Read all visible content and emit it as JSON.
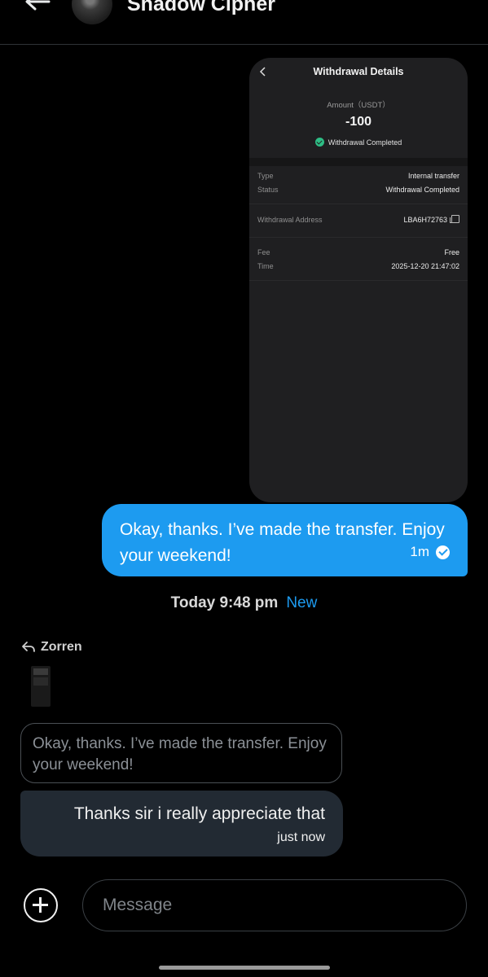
{
  "header": {
    "contact_name": "Shadow Cipher"
  },
  "attachment": {
    "title": "Withdrawal Details",
    "amount_label": "Amount（USDT）",
    "amount": "-100",
    "status_badge": "Withdrawal Completed",
    "group1": [
      {
        "key": "Type",
        "value": "Internal transfer"
      },
      {
        "key": "Status",
        "value": "Withdrawal Completed"
      }
    ],
    "address_key": "Withdrawal Address",
    "address_value": "LBA6H72763",
    "group3": [
      {
        "key": "Fee",
        "value": "Free"
      },
      {
        "key": "Time",
        "value": "2025-12-20 21:47:02"
      }
    ]
  },
  "outgoing": {
    "text": "Okay, thanks. I’ve made the transfer. Enjoy your weekend!",
    "time": "1m"
  },
  "divider": {
    "time": "Today 9:48 pm",
    "new_label": "New"
  },
  "incoming": {
    "reply_to": "Zorren",
    "quoted_text": "Okay, thanks. I’ve made the transfer. Enjoy your weekend!",
    "text": "Thanks sir i really appreciate that",
    "time": "just now"
  },
  "composer": {
    "placeholder": "Message"
  },
  "colors": {
    "accent": "#1d9bf0",
    "incoming_bubble": "#222a33",
    "success": "#2ebd85"
  }
}
